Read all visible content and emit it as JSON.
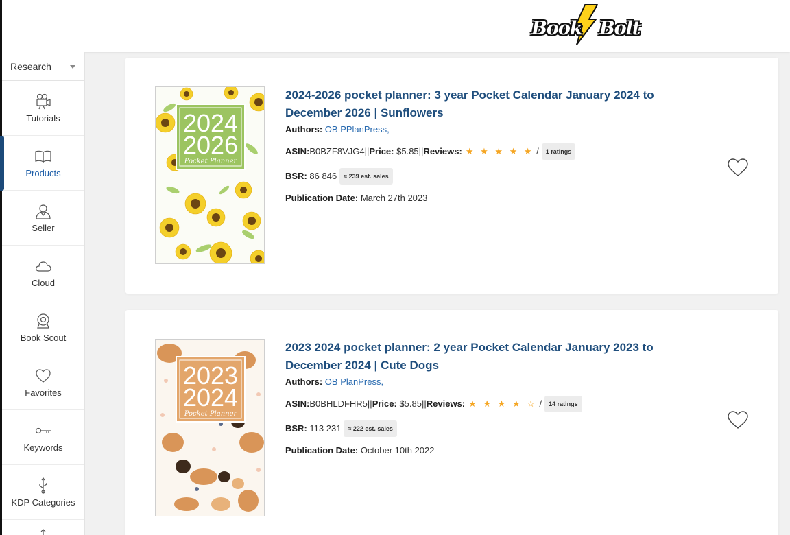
{
  "brand": {
    "name": "Book Bolt",
    "word1": "Book",
    "word2": "Bolt"
  },
  "sidebar": {
    "section": "Research",
    "items": [
      {
        "label": "Tutorials",
        "icon": "camera-icon"
      },
      {
        "label": "Products",
        "icon": "book-icon",
        "active": true
      },
      {
        "label": "Seller",
        "icon": "user-icon"
      },
      {
        "label": "Cloud",
        "icon": "cloud-icon"
      },
      {
        "label": "Book Scout",
        "icon": "webcam-icon"
      },
      {
        "label": "Favorites",
        "icon": "heart-icon"
      },
      {
        "label": "Keywords",
        "icon": "key-icon"
      },
      {
        "label": "KDP Categories",
        "icon": "usb-icon"
      }
    ]
  },
  "labels": {
    "authors": "Authors:",
    "asin": "ASIN:",
    "price": "Price:",
    "reviews": "Reviews:",
    "bsr": "BSR:",
    "pub_date": "Publication Date:",
    "sep": " || "
  },
  "products": [
    {
      "title_line1": "2024-2026 pocket planner: 3 year Pocket Calendar January 2024 to",
      "title_line2": "December 2026 | Sunflowers",
      "author": "OB PPlanPress,",
      "asin": "B0BZF8VJG4",
      "price": "$5.85",
      "stars": "★ ★ ★ ★ ★",
      "stars_value": 5,
      "stars_sep": "/",
      "ratings": "1 ratings",
      "bsr": "86 846",
      "est_sales": "≈ 239 est. sales",
      "pub_date": "March 27th 2023",
      "cover": {
        "year1": "2024",
        "year2": "2026",
        "subtitle": "Pocket Planner",
        "theme": "sunflowers",
        "accent": "#8fbe5a"
      }
    },
    {
      "title_line1": "2023 2024 pocket planner: 2 year Pocket Calendar January 2023 to",
      "title_line2": "December 2024 | Cute Dogs",
      "author": "OB PlanPress,",
      "asin": "B0BHLDFHR5",
      "price": "$5.85",
      "stars": "★ ★ ★ ★ ☆",
      "stars_value": 4,
      "stars_sep": "/",
      "ratings": "14 ratings",
      "bsr": "113 231",
      "est_sales": "≈ 222 est. sales",
      "pub_date": "October 10th 2022",
      "cover": {
        "year1": "2023",
        "year2": "2024",
        "subtitle": "Pocket Planner",
        "theme": "dogs",
        "accent": "#e0a872"
      }
    }
  ],
  "colors": {
    "title": "#1f4e7d",
    "link": "#2a6bb0",
    "star": "#f5a623",
    "active_nav": "#1c4a7a"
  }
}
